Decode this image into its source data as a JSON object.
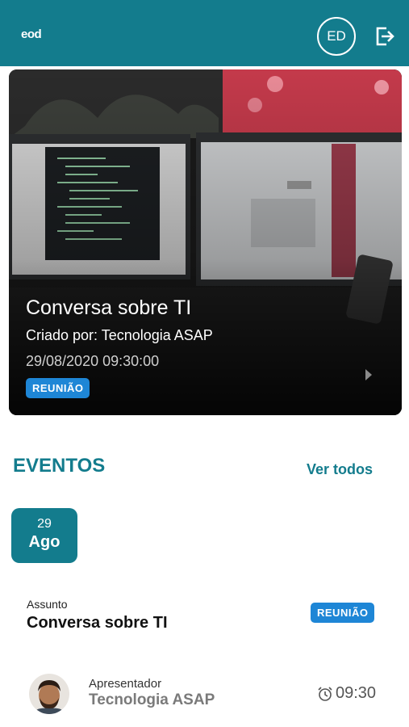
{
  "header": {
    "logo_text": "eod",
    "user_initials": "ED",
    "logout_icon": "logout-icon",
    "bg_color": "#137c8d"
  },
  "featured": {
    "title": "Conversa sobre TI",
    "creator": "Criado por: Tecnologia ASAP",
    "datetime": "29/08/2020 09:30:00",
    "badge": "REUNIÃO",
    "badge_color": "#1e86d6"
  },
  "events": {
    "section_title": "EVENTOS",
    "see_all": "Ver todos",
    "items": [
      {
        "date_day": "29",
        "date_month": "Ago",
        "subject_label": "Assunto",
        "subject": "Conversa sobre TI",
        "badge": "REUNIÃO",
        "presenter_label": "Apresentador",
        "presenter": "Tecnologia ASAP",
        "time": "09:30",
        "time_icon": "alarm-clock-icon"
      }
    ]
  }
}
